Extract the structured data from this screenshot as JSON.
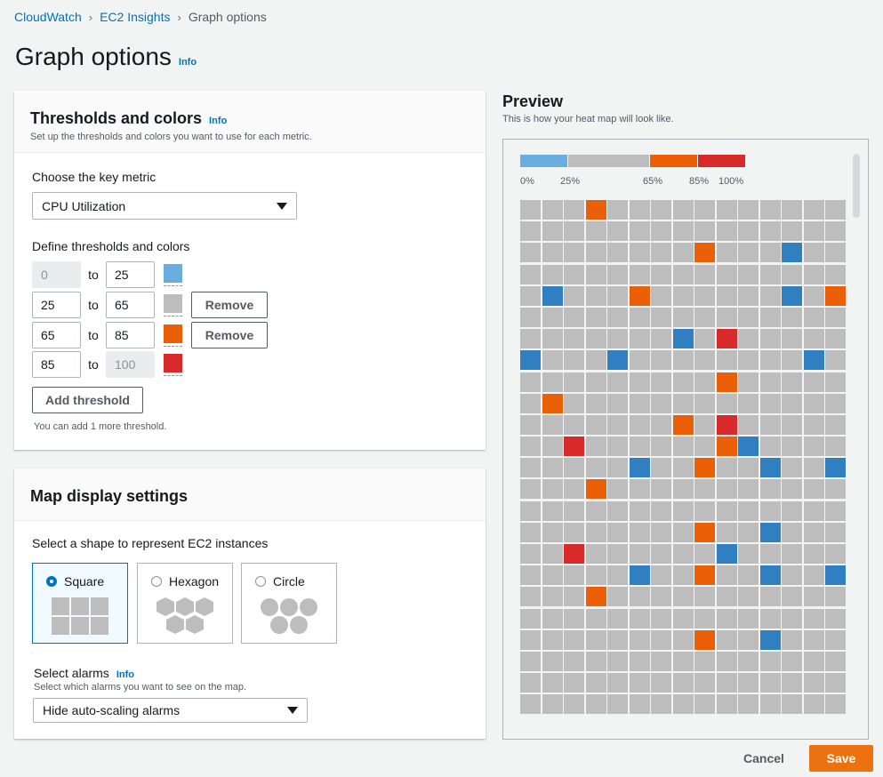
{
  "breadcrumb": {
    "items": [
      "CloudWatch",
      "EC2 Insights"
    ],
    "current": "Graph options"
  },
  "page": {
    "title": "Graph options",
    "info": "Info"
  },
  "thresholds": {
    "title": "Thresholds and colors",
    "info": "Info",
    "subtitle": "Set up the thresholds and colors you want to use for each metric.",
    "key_metric_label": "Choose the key metric",
    "key_metric_value": "CPU Utilization",
    "define_label": "Define thresholds and colors",
    "to_label": "to",
    "rows": [
      {
        "from": "0",
        "to": "25",
        "color": "#69aedf"
      },
      {
        "from": "25",
        "to": "65",
        "color": "#bdbdbd"
      },
      {
        "from": "65",
        "to": "85",
        "color": "#eb5f07"
      },
      {
        "from": "85",
        "to": "100",
        "color": "#d82a2a"
      }
    ],
    "remove_label": "Remove",
    "add_label": "Add threshold",
    "hint": "You can add 1 more threshold."
  },
  "map_display": {
    "title": "Map display settings",
    "shape_label": "Select a shape to represent EC2 instances",
    "shapes": [
      "Square",
      "Hexagon",
      "Circle"
    ],
    "selected_shape": "Square",
    "alarms_label": "Select alarms",
    "alarms_info": "Info",
    "alarms_hint": "Select which alarms you want to see on the map.",
    "alarms_value": "Hide auto-scaling alarms"
  },
  "preview": {
    "title": "Preview",
    "subtitle": "This is how your heat map will look like.",
    "legend_labels": [
      "0%",
      "25%",
      "65%",
      "85%",
      "100%"
    ],
    "legend_colors": [
      "#69aedf",
      "#bdbdbd",
      "#eb5f07",
      "#d82a2a"
    ],
    "colors": {
      "g": "#bdbdbd",
      "b": "#2f7fc1",
      "o": "#eb5f07",
      "r": "#d82a2a"
    },
    "grid_rows": [
      "gggoggggggggggg",
      "ggggggggggggggg",
      "ggggggggogggbgg",
      "ggggggggggggggg",
      "gbgggoggggggbgo",
      "ggggggggggggggg",
      "gggggggbgrggggg",
      "bgggbggggggggbg",
      "gggggggggoggggg",
      "gogggggggggggggg",
      "gggggggogrggggg",
      "ggrggggggobgggg",
      "gggggbggoggbggb",
      "gggoggggggggggg",
      "ggggggggggggggg",
      "ggggggggoggbggg",
      "ggrggggggbggggg",
      "gggggbggoggbggb",
      "gggoggggggggggg",
      "ggggggggggggggg",
      "ggggggggoggbggg",
      "ggggggggggggggg",
      "ggggggggggggggg",
      "ggggggggggggggg"
    ]
  },
  "footer": {
    "cancel": "Cancel",
    "save": "Save"
  }
}
